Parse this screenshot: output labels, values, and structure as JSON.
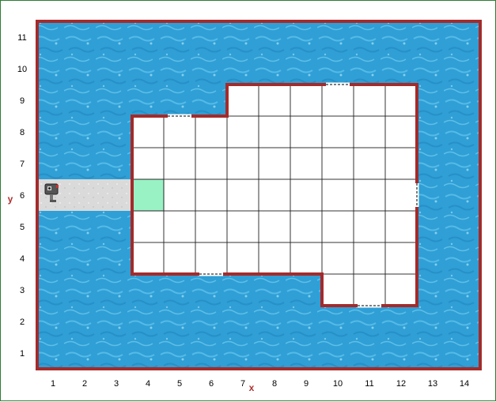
{
  "grid": {
    "columns": 14,
    "rows": 11,
    "x_axis_label": "x",
    "y_axis_label": "y",
    "x_ticks": [
      "1",
      "2",
      "3",
      "4",
      "5",
      "6",
      "7",
      "8",
      "9",
      "10",
      "11",
      "12",
      "13",
      "14"
    ],
    "y_ticks": [
      "1",
      "2",
      "3",
      "4",
      "5",
      "6",
      "7",
      "8",
      "9",
      "10",
      "11"
    ]
  },
  "colors": {
    "water": "#2f9fd6",
    "water_light": "#5cc0ea",
    "wall": "#a52a2a",
    "floor": "#ffffff",
    "grid_line": "#222222",
    "path": "#d9d9d9",
    "start_tile": "#99f2c4",
    "frame": "#2e7d32"
  },
  "room": {
    "outline_cells": [
      [
        4,
        3
      ],
      [
        9,
        3
      ],
      [
        9,
        2
      ],
      [
        12,
        2
      ],
      [
        12,
        10
      ],
      [
        6.5,
        10
      ],
      [
        6.5,
        9
      ],
      [
        4,
        9
      ]
    ],
    "floor_cells": [
      [
        4,
        4
      ],
      [
        5,
        4
      ],
      [
        6,
        4
      ],
      [
        7,
        4
      ],
      [
        8,
        4
      ],
      [
        9,
        4
      ],
      [
        10,
        4
      ],
      [
        11,
        4
      ],
      [
        12,
        4
      ],
      [
        4,
        5
      ],
      [
        5,
        5
      ],
      [
        6,
        5
      ],
      [
        7,
        5
      ],
      [
        8,
        5
      ],
      [
        9,
        5
      ],
      [
        10,
        5
      ],
      [
        11,
        5
      ],
      [
        12,
        5
      ],
      [
        4,
        6
      ],
      [
        5,
        6
      ],
      [
        6,
        6
      ],
      [
        7,
        6
      ],
      [
        8,
        6
      ],
      [
        9,
        6
      ],
      [
        10,
        6
      ],
      [
        11,
        6
      ],
      [
        12,
        6
      ],
      [
        4,
        7
      ],
      [
        5,
        7
      ],
      [
        6,
        7
      ],
      [
        7,
        7
      ],
      [
        8,
        7
      ],
      [
        9,
        7
      ],
      [
        10,
        7
      ],
      [
        11,
        7
      ],
      [
        12,
        7
      ],
      [
        4,
        8
      ],
      [
        5,
        8
      ],
      [
        6,
        8
      ],
      [
        7,
        8
      ],
      [
        8,
        8
      ],
      [
        9,
        8
      ],
      [
        10,
        8
      ],
      [
        11,
        8
      ],
      [
        12,
        8
      ],
      [
        7,
        9
      ],
      [
        8,
        9
      ],
      [
        9,
        9
      ],
      [
        10,
        9
      ],
      [
        11,
        9
      ],
      [
        12,
        9
      ],
      [
        10,
        3
      ],
      [
        11,
        3
      ],
      [
        12,
        3
      ]
    ]
  },
  "doors": [
    {
      "name": "door-top-left",
      "x": 5,
      "y": 8,
      "side": "top"
    },
    {
      "name": "door-top-right",
      "x": 10,
      "y": 9,
      "side": "top"
    },
    {
      "name": "door-bottom-left",
      "x": 6,
      "y": 4,
      "side": "bottom"
    },
    {
      "name": "door-bottom-right",
      "x": 11,
      "y": 3,
      "side": "bottom"
    },
    {
      "name": "door-right",
      "x": 12,
      "y": 6,
      "side": "right"
    }
  ],
  "path_cells": [
    [
      1,
      6
    ],
    [
      2,
      6
    ],
    [
      3,
      6
    ]
  ],
  "start_tile": {
    "x": 4,
    "y": 6
  },
  "robot": {
    "x": 1,
    "y": 6,
    "icon": "robot-icon"
  }
}
